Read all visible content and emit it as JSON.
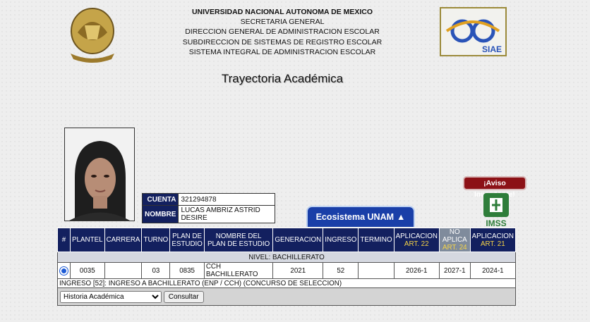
{
  "header": {
    "lines": [
      "UNIVERSIDAD NACIONAL AUTONOMA DE MEXICO",
      "SECRETARIA GENERAL",
      "DIRECCION GENERAL DE ADMINISTRACION ESCOLAR",
      "SUBDIRECCION DE SISTEMAS DE REGISTRO ESCOLAR",
      "SISTEMA INTEGRAL DE ADMINISTRACION ESCOLAR"
    ],
    "logo_right_text": "SIAE"
  },
  "title": "Trayectoria Académica",
  "student": {
    "cuenta_label": "CUENTA",
    "cuenta": "321294878",
    "nombre_label": "NOMBRE",
    "nombre": "LUCAS AMBRIZ ASTRID DESIRE"
  },
  "aviso_label": "¡Aviso Importante!",
  "imss_label": "IMSS",
  "ecosistema_label": "Ecosistema UNAM",
  "table": {
    "headers": {
      "num": "#",
      "plantel": "PLANTEL",
      "carrera": "CARRERA",
      "turno": "TURNO",
      "plan1": "PLAN DE",
      "plan2": "ESTUDIO",
      "nombre_plan": "NOMBRE DEL PLAN DE ESTUDIO",
      "generacion": "GENERACION",
      "ingreso": "INGRESO",
      "termino": "TERMINO",
      "apl22a": "APLICACION",
      "apl22b": "ART. 22",
      "na24a": "NO APLICA",
      "na24b": "ART. 24",
      "apl21a": "APLICACION",
      "apl21b": "ART. 21"
    },
    "nivel": "NIVEL: BACHILLERATO",
    "row": {
      "plantel": "0035",
      "carrera": "",
      "turno": "03",
      "plan": "0835",
      "nombre_plan": "CCH BACHILLERATO",
      "generacion": "2021",
      "ingreso": "52",
      "termino": "",
      "art22": "2026-1",
      "art24": "2027-1",
      "art21": "2024-1"
    },
    "ingreso_text": "INGRESO [52]: INGRESO A BACHILLERATO (ENP / CCH) (CONCURSO DE SELECCION)",
    "select_value": "Historia Académica",
    "consultar_label": "Consultar"
  },
  "colors": {
    "header_bg": "#13205f",
    "accent": "#1a3fa8",
    "aviso_bg": "#8c1116"
  }
}
